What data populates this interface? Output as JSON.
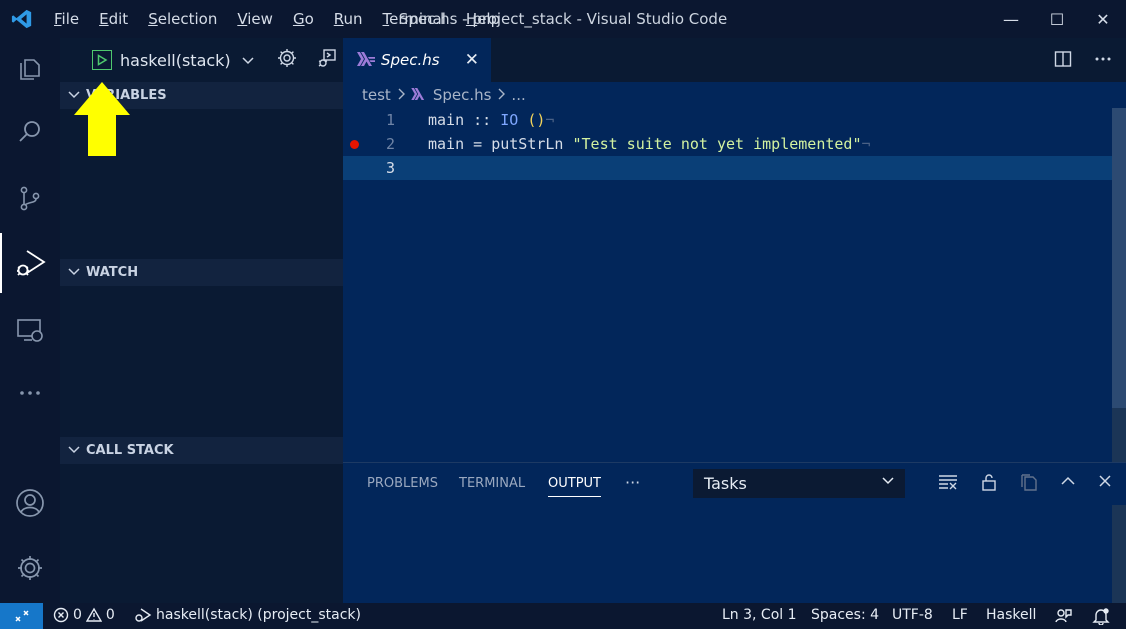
{
  "titlebar": {
    "app_icon": "vscode-logo-icon",
    "menu": [
      "File",
      "Edit",
      "Selection",
      "View",
      "Go",
      "Run",
      "Terminal",
      "Help"
    ],
    "window_title": "Spec.hs - project_stack - Visual Studio Code",
    "controls": {
      "minimize": "—",
      "maximize": "☐",
      "close": "✕"
    }
  },
  "activity_bar": {
    "items": [
      "explorer-icon",
      "search-icon",
      "source-control-icon",
      "run-debug-icon",
      "remote-explorer-icon",
      "more-icon"
    ],
    "bottom": [
      "account-icon",
      "manage-gear-icon"
    ],
    "active": "run-debug-icon"
  },
  "sidebar": {
    "config_name": "haskell(stack)",
    "sections": {
      "variables": "VARIABLES",
      "watch": "WATCH",
      "call_stack": "CALL STACK"
    }
  },
  "editor": {
    "tab": {
      "label": "Spec.hs",
      "close": "✕"
    },
    "breadcrumb": {
      "folder": "test",
      "file": "Spec.hs",
      "more": "..."
    },
    "lines": [
      {
        "n": "1",
        "code_a": "main",
        "code_b": " :: ",
        "code_c": "IO",
        "code_d": " ()",
        "eol": "¬"
      },
      {
        "n": "2",
        "code_a": "main",
        "code_b": " = putStrLn ",
        "code_c": "\"Test suite not yet implemented\"",
        "eol": "¬"
      },
      {
        "n": "3"
      }
    ]
  },
  "panel": {
    "tabs": [
      "PROBLEMS",
      "TERMINAL",
      "OUTPUT"
    ],
    "more": "···",
    "active_tab": "OUTPUT",
    "task_select": "Tasks"
  },
  "statusbar": {
    "errors": "0",
    "warnings": "0",
    "debug_config": "haskell(stack) (project_stack)",
    "position": "Ln 3, Col 1",
    "spaces": "Spaces: 4",
    "encoding": "UTF-8",
    "eol": "LF",
    "language": "Haskell"
  },
  "colors": {
    "editor_bg": "#02265a",
    "sidebar_bg": "#0a1a33",
    "accent": "#1677c9",
    "breakpoint": "#e51400",
    "annotation": "#ffff00"
  }
}
